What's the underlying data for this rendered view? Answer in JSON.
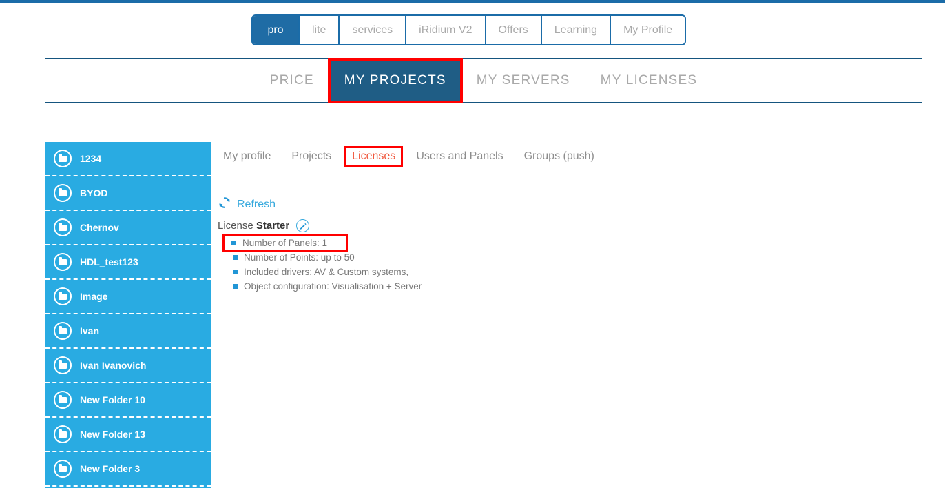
{
  "theme": {
    "accent_dark_blue": "#1b6ca8",
    "accent_light_blue": "#29abe2",
    "nav_active_bg": "#1f5d85",
    "annotation_red": "#ff0000",
    "active_subtab_color": "#f0553a"
  },
  "product_tabs": [
    {
      "label": "pro",
      "active": true
    },
    {
      "label": "lite",
      "active": false
    },
    {
      "label": "services",
      "active": false
    },
    {
      "label": "iRidium V2",
      "active": false
    },
    {
      "label": "Offers",
      "active": false
    },
    {
      "label": "Learning",
      "active": false
    },
    {
      "label": "My Profile",
      "active": false
    }
  ],
  "main_nav": [
    {
      "label": "PRICE",
      "active": false
    },
    {
      "label": "MY PROJECTS",
      "active": true
    },
    {
      "label": "MY SERVERS",
      "active": false
    },
    {
      "label": "MY LICENSES",
      "active": false
    }
  ],
  "sidebar": {
    "items": [
      {
        "label": "1234",
        "icon": "folder-icon"
      },
      {
        "label": "BYOD",
        "icon": "folder-icon"
      },
      {
        "label": "Chernov",
        "icon": "folder-icon"
      },
      {
        "label": "HDL_test123",
        "icon": "folder-icon"
      },
      {
        "label": "Image",
        "icon": "folder-icon"
      },
      {
        "label": "Ivan",
        "icon": "folder-icon"
      },
      {
        "label": "Ivan Ivanovich",
        "icon": "folder-icon"
      },
      {
        "label": "New Folder 10",
        "icon": "folder-icon"
      },
      {
        "label": "New Folder 13",
        "icon": "folder-icon"
      },
      {
        "label": "New Folder 3",
        "icon": "folder-icon"
      }
    ]
  },
  "content": {
    "sub_tabs": [
      {
        "label": "My profile",
        "active": false
      },
      {
        "label": "Projects",
        "active": false
      },
      {
        "label": "Licenses",
        "active": true
      },
      {
        "label": "Users and Panels",
        "active": false
      },
      {
        "label": "Groups (push)",
        "active": false
      }
    ],
    "refresh": {
      "label": "Refresh",
      "icon": "refresh-icon"
    },
    "license": {
      "prefix": "License ",
      "name": "Starter",
      "edit_icon": "pencil-icon",
      "features": [
        {
          "text": "Number of Panels: 1",
          "highlighted": true
        },
        {
          "text": "Number of Points: up to 50",
          "highlighted": false
        },
        {
          "text": "Included drivers: AV & Custom systems,",
          "highlighted": false
        },
        {
          "text": "Object configuration: Visualisation + Server",
          "highlighted": false
        }
      ]
    }
  }
}
